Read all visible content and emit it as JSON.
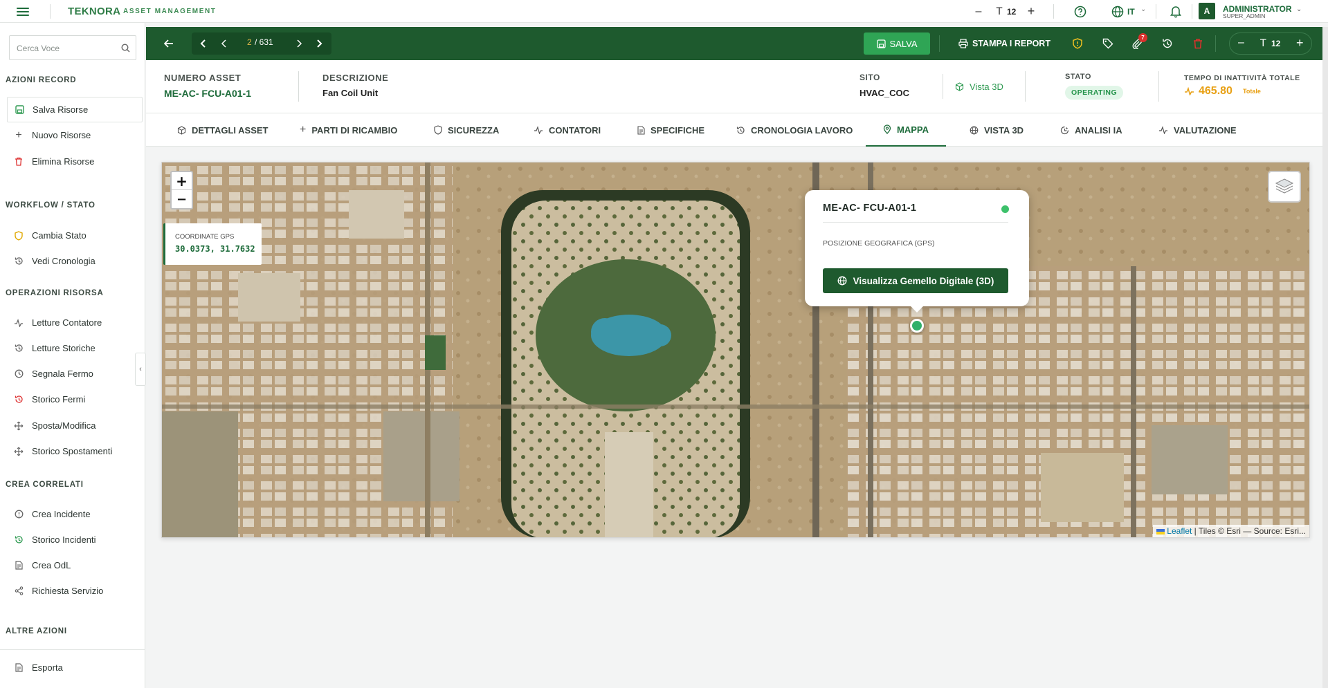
{
  "app": {
    "brand": "TEKNORA",
    "brand_sub": "ASSET MANAGEMENT",
    "accent": "#1e5a2e"
  },
  "topbar": {
    "font_size": "12",
    "lang": "IT",
    "user_initial": "A",
    "user_name": "ADMINISTRATOR",
    "user_role": "SUPER_ADMIN"
  },
  "sidebar": {
    "search_placeholder": "Cerca Voce",
    "sections": [
      {
        "title": "AZIONI RECORD",
        "items": [
          {
            "label": "Salva Risorse",
            "icon": "save-icon"
          },
          {
            "label": "Nuovo Risorse",
            "icon": "plus-icon"
          },
          {
            "label": "Elimina Risorse",
            "icon": "trash-icon"
          }
        ]
      },
      {
        "title": "WORKFLOW / STATO",
        "items": [
          {
            "label": "Cambia Stato",
            "icon": "shield-icon"
          },
          {
            "label": "Vedi Cronologia",
            "icon": "history-icon"
          }
        ]
      },
      {
        "title": "OPERAZIONI RISORSA",
        "items": [
          {
            "label": "Letture Contatore",
            "icon": "pulse-icon"
          },
          {
            "label": "Letture Storiche",
            "icon": "history-icon"
          },
          {
            "label": "Segnala Fermo",
            "icon": "clock-icon"
          },
          {
            "label": "Storico Fermi",
            "icon": "history-icon"
          },
          {
            "label": "Sposta/Modifica",
            "icon": "move-icon"
          },
          {
            "label": "Storico Spostamenti",
            "icon": "move-icon"
          }
        ]
      },
      {
        "title": "CREA CORRELATI",
        "items": [
          {
            "label": "Crea Incidente",
            "icon": "alert-icon"
          },
          {
            "label": "Storico Incidenti",
            "icon": "history-icon"
          },
          {
            "label": "Crea OdL",
            "icon": "document-icon"
          },
          {
            "label": "Richiesta Servizio",
            "icon": "share-icon"
          }
        ]
      },
      {
        "title": "ALTRE AZIONI",
        "items": [
          {
            "label": "Esporta",
            "icon": "document-icon"
          }
        ]
      }
    ]
  },
  "toolbar": {
    "page_current": "2",
    "page_total": "/ 631",
    "save_label": "SALVA",
    "print_label": "STAMPA I REPORT",
    "attachments_count": "7",
    "zoom_value": "12"
  },
  "header": {
    "asset_number_label": "NUMERO ASSET",
    "asset_number": "ME-AC- FCU-A01-1",
    "description_label": "DESCRIZIONE",
    "description": "Fan Coil Unit",
    "site_label": "SITO",
    "site": "HVAC_COC",
    "view3d_label": "Vista 3D",
    "status_label": "STATO",
    "status": "OPERATING",
    "downtime_label": "TEMPO DI INATTIVITÀ TOTALE",
    "downtime_value": "465.80",
    "downtime_unit": "Totale"
  },
  "tabs": [
    {
      "label": "DETTAGLI ASSET",
      "icon": "cube-icon"
    },
    {
      "label": "PARTI DI RICAMBIO",
      "icon": "plus-icon"
    },
    {
      "label": "SICUREZZA",
      "icon": "shield-icon"
    },
    {
      "label": "CONTATORI",
      "icon": "pulse-icon"
    },
    {
      "label": "SPECIFICHE",
      "icon": "document-icon"
    },
    {
      "label": "CRONOLOGIA LAVORO",
      "icon": "history-icon"
    },
    {
      "label": "MAPPA",
      "icon": "pin-icon",
      "active": true
    },
    {
      "label": "VISTA 3D",
      "icon": "globe-icon"
    },
    {
      "label": "ANALISI IA",
      "icon": "ai-icon"
    },
    {
      "label": "VALUTAZIONE",
      "icon": "pulse-icon"
    }
  ],
  "map": {
    "gps_label": "COORDINATE GPS",
    "gps_value": "30.0373, 31.7632",
    "zoom_in": "+",
    "zoom_out": "−",
    "popup_title": "ME-AC- FCU-A01-1",
    "popup_subtitle": "POSIZIONE GEOGRAFICA (GPS)",
    "popup_button": "Visualizza Gemello Digitale (3D)",
    "attribution_link": "Leaflet",
    "attribution_text": "| Tiles © Esri — Source: Esri..."
  }
}
